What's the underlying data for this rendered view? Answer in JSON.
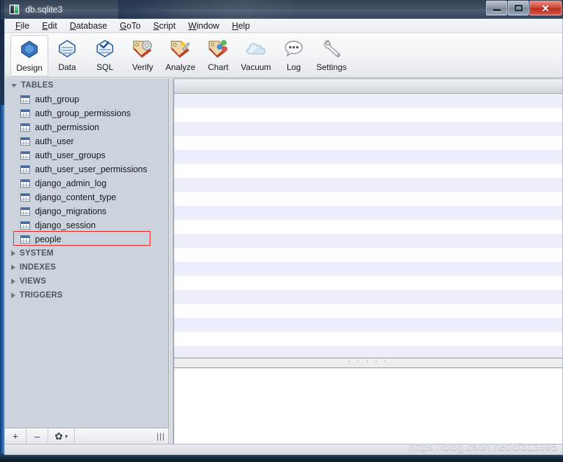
{
  "window": {
    "title": "db.sqlite3",
    "icon": "app-icon",
    "buttons": {
      "minimize": "–",
      "maximize": "□",
      "close": "✕"
    }
  },
  "menubar": {
    "items": [
      {
        "label": "File",
        "accel": "F"
      },
      {
        "label": "Edit",
        "accel": "E"
      },
      {
        "label": "Database",
        "accel": "D"
      },
      {
        "label": "GoTo",
        "accel": "G"
      },
      {
        "label": "Script",
        "accel": "S"
      },
      {
        "label": "Window",
        "accel": "W"
      },
      {
        "label": "Help",
        "accel": "H"
      }
    ]
  },
  "toolbar": {
    "items": [
      {
        "label": "Design",
        "icon": "design-icon",
        "active": true
      },
      {
        "label": "Data",
        "icon": "data-icon",
        "active": false
      },
      {
        "label": "SQL",
        "icon": "sql-icon",
        "active": false
      },
      {
        "label": "Verify",
        "icon": "verify-icon",
        "active": false
      },
      {
        "label": "Analyze",
        "icon": "analyze-icon",
        "active": false
      },
      {
        "label": "Chart",
        "icon": "chart-icon",
        "active": false
      },
      {
        "label": "Vacuum",
        "icon": "vacuum-icon",
        "active": false
      },
      {
        "label": "Log",
        "icon": "log-icon",
        "active": false
      },
      {
        "label": "Settings",
        "icon": "settings-icon",
        "active": false
      }
    ]
  },
  "sidebar": {
    "groups": [
      {
        "label": "TABLES",
        "expanded": true
      },
      {
        "label": "SYSTEM",
        "expanded": false
      },
      {
        "label": "INDEXES",
        "expanded": false
      },
      {
        "label": "VIEWS",
        "expanded": false
      },
      {
        "label": "TRIGGERS",
        "expanded": false
      }
    ],
    "tables": [
      {
        "name": "auth_group",
        "highlighted": false
      },
      {
        "name": "auth_group_permissions",
        "highlighted": false
      },
      {
        "name": "auth_permission",
        "highlighted": false
      },
      {
        "name": "auth_user",
        "highlighted": false
      },
      {
        "name": "auth_user_groups",
        "highlighted": false
      },
      {
        "name": "auth_user_user_permissions",
        "highlighted": false
      },
      {
        "name": "django_admin_log",
        "highlighted": false
      },
      {
        "name": "django_content_type",
        "highlighted": false
      },
      {
        "name": "django_migrations",
        "highlighted": false
      },
      {
        "name": "django_session",
        "highlighted": false
      },
      {
        "name": "people",
        "highlighted": true
      }
    ],
    "bottom_bar": {
      "add_label": "+",
      "remove_label": "–",
      "gear_label": "✿",
      "gear_caret": "▾",
      "grip_label": "|||"
    }
  },
  "main": {
    "splitter_dots": "· · · · ·",
    "row_count": 19
  },
  "watermark": {
    "text": "https://blog.csdn.net/cf313995"
  },
  "colors": {
    "accent_blue": "#3b6fb5",
    "highlight_red": "#ee2222",
    "row_stripe": "#eceff9",
    "sidebar_bg": "#ccd3dc",
    "close_red": "#b52f1f"
  }
}
